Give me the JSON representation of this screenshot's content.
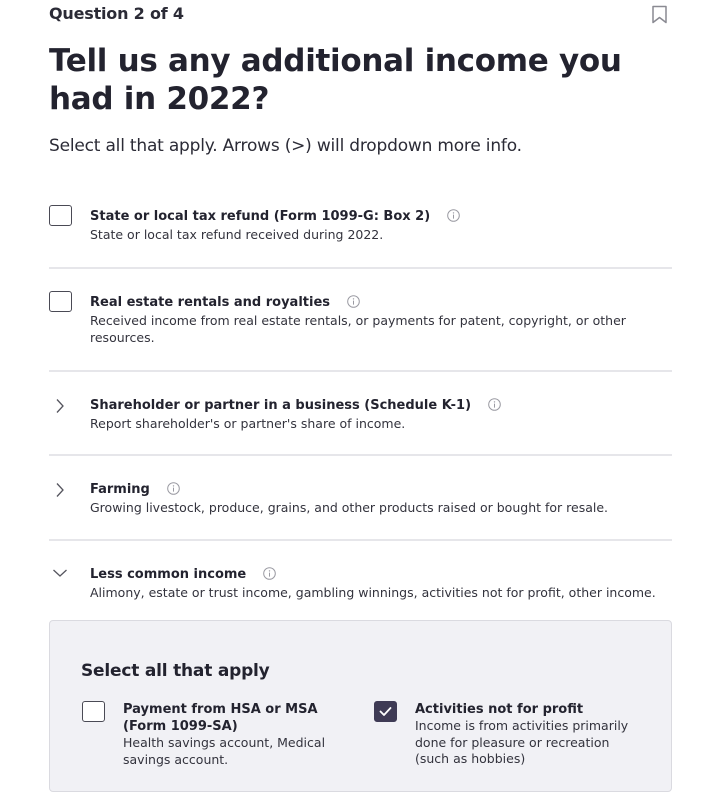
{
  "header": {
    "question_counter": "Question 2 of 4",
    "bookmark_icon": "bookmark-icon"
  },
  "title": "Tell us any additional income you had in 2022?",
  "subtitle": "Select all that apply. Arrows (>) will dropdown more info.",
  "options": [
    {
      "control": "checkbox",
      "checked": false,
      "label": "State or local tax refund (Form 1099-G: Box 2)",
      "description": "State or local tax refund received during 2022.",
      "icon": "info-icon"
    },
    {
      "control": "checkbox",
      "checked": false,
      "label": "Real estate rentals and royalties",
      "description": "Received income from real estate rentals, or payments for patent, copyright, or other resources.",
      "icon": "info-icon"
    },
    {
      "control": "chevron-right",
      "expanded": false,
      "label": "Shareholder or partner in a business (Schedule K-1)",
      "description": "Report shareholder's or partner's share of income.",
      "icon": "info-icon"
    },
    {
      "control": "chevron-right",
      "expanded": false,
      "label": "Farming",
      "description": "Growing livestock, produce, grains, and other products raised or bought for resale.",
      "icon": "info-icon"
    },
    {
      "control": "chevron-down",
      "expanded": true,
      "label": "Less common income",
      "description": "Alimony, estate or trust income, gambling winnings, activities not for profit, other income.",
      "icon": "info-icon"
    }
  ],
  "less_common_panel": {
    "title": "Select all that apply",
    "options": [
      {
        "checked": false,
        "label": "Payment from HSA or MSA (Form 1099-SA)",
        "description": "Health savings account, Medical savings account."
      },
      {
        "checked": true,
        "label": "Activities not for profit",
        "description": "Income is from activities primarily done for pleasure or recreation (such as hobbies)"
      }
    ]
  },
  "colors": {
    "text": "#23232f",
    "checked_fill": "#3f3b55",
    "divider": "#e6e6ea",
    "panel_bg": "#f1f1f5"
  }
}
